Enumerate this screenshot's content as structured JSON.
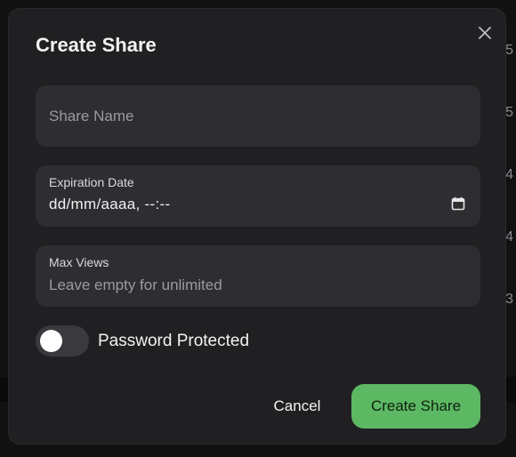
{
  "background": {
    "row_digits": [
      "5",
      "5",
      "4",
      "4",
      "3"
    ]
  },
  "dialog": {
    "title": "Create Share",
    "close_icon": "close-icon",
    "share_name": {
      "placeholder": "Share Name",
      "value": ""
    },
    "expiration": {
      "label": "Expiration Date",
      "value": "dd/mm/aaaa, --:--",
      "icon": "calendar-icon"
    },
    "max_views": {
      "label": "Max Views",
      "placeholder": "Leave empty for unlimited",
      "value": ""
    },
    "password_toggle": {
      "label": "Password Protected",
      "enabled": false
    },
    "buttons": {
      "cancel": "Cancel",
      "create": "Create Share"
    }
  },
  "colors": {
    "dialog_bg": "#202022",
    "field_bg": "#2e2e31",
    "accent_green": "#5cb863",
    "toggle_off": "#3a3a3e"
  }
}
